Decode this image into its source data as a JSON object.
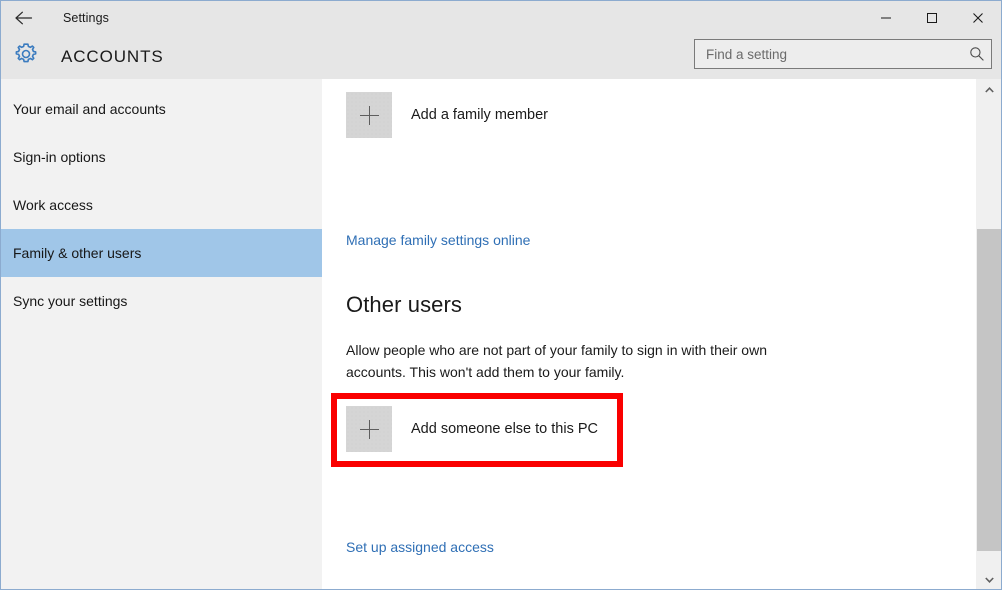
{
  "window": {
    "titlebar_title": "Settings",
    "controls": {
      "back": "back-arrow",
      "minimize": "minimize",
      "maximize": "maximize",
      "close": "close"
    },
    "accent_border": "#8cabcf",
    "titlebar_bg": "#e6e6e6"
  },
  "header": {
    "icon": "gear-icon",
    "title": "ACCOUNTS",
    "accent_color": "#3a7bbf"
  },
  "search": {
    "placeholder": "Find a setting",
    "value": "",
    "icon": "search-icon"
  },
  "sidebar": {
    "selected_index": 3,
    "selected_bg": "#a0c6e8",
    "items": [
      {
        "label": "Your email and accounts",
        "selected": false
      },
      {
        "label": "Sign-in options",
        "selected": false
      },
      {
        "label": "Work access",
        "selected": false
      },
      {
        "label": "Family & other users",
        "selected": true
      },
      {
        "label": "Sync your settings",
        "selected": false
      }
    ]
  },
  "main": {
    "add_family_member": {
      "label": "Add a family member",
      "icon": "plus-icon"
    },
    "manage_family_link": "Manage family settings online",
    "other_users": {
      "heading": "Other users",
      "description": "Allow people who are not part of your family to sign in with their own accounts. This won't add them to your family.",
      "add_someone": {
        "label": "Add someone else to this PC",
        "icon": "plus-icon"
      }
    },
    "assigned_access_link": "Set up assigned access"
  },
  "annotation": {
    "color": "#fa0000",
    "target": "add-someone-else-to-this-pc"
  },
  "scrollbar": {
    "up_arrow": "chevron-up-icon",
    "down_arrow": "chevron-down-icon",
    "thumb_position": "middle"
  }
}
